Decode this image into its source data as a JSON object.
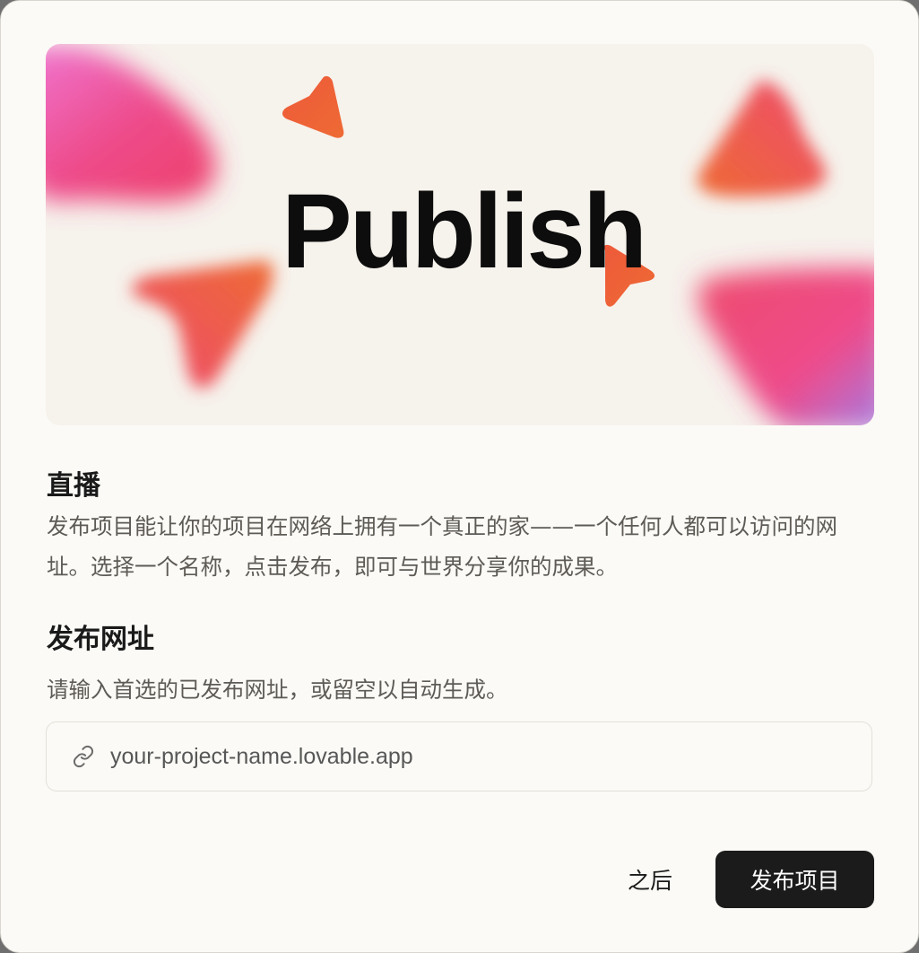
{
  "hero": {
    "word": "Publish",
    "colors": {
      "background": "#f6f2ec",
      "pink": "#ee4b8a",
      "orange": "#ee6a34",
      "violet": "#a07ee8",
      "magenta": "#f07ad8"
    }
  },
  "live": {
    "title": "直播",
    "description": "发布项目能让你的项目在网络上拥有一个真正的家——一个任何人都可以访问的网址。选择一个名称，点击发布，即可与世界分享你的成果。"
  },
  "publish_url": {
    "title": "发布网址",
    "hint": "请输入首选的已发布网址，或留空以自动生成。",
    "value": "",
    "placeholder": "your-project-name.lovable.app",
    "icon": "link-icon"
  },
  "actions": {
    "later_label": "之后",
    "publish_label": "发布项目"
  }
}
